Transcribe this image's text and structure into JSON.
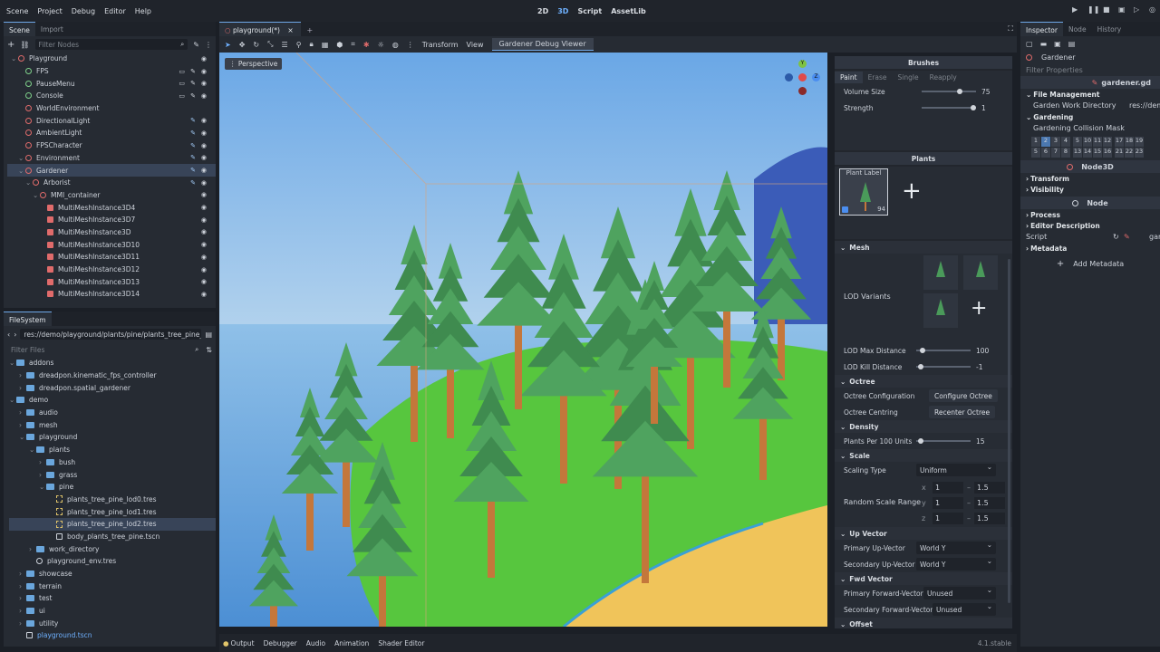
{
  "menu": [
    "Scene",
    "Project",
    "Debug",
    "Editor",
    "Help"
  ],
  "main_screens": [
    {
      "label": "2D",
      "active": false
    },
    {
      "label": "3D",
      "active": true
    },
    {
      "label": "Script",
      "active": false
    },
    {
      "label": "AssetLib",
      "active": false
    }
  ],
  "scene_dock": {
    "tabs": [
      "Scene",
      "Import"
    ],
    "filter_placeholder": "Filter Nodes",
    "nodes": [
      {
        "label": "Playground",
        "indent": 0,
        "icon": "node3d-icon",
        "eye": true
      },
      {
        "label": "FPS",
        "indent": 1,
        "icon": "control-icon",
        "eye": true
      },
      {
        "label": "PauseMenu",
        "indent": 1,
        "icon": "control-icon",
        "eye": true
      },
      {
        "label": "Console",
        "indent": 1,
        "icon": "control-icon",
        "eye": true
      },
      {
        "label": "WorldEnvironment",
        "indent": 1,
        "icon": "node3d-icon",
        "eye": false
      },
      {
        "label": "DirectionalLight",
        "indent": 1,
        "icon": "node3d-icon",
        "eye": true
      },
      {
        "label": "AmbientLight",
        "indent": 1,
        "icon": "node3d-icon",
        "eye": true
      },
      {
        "label": "FPSCharacter",
        "indent": 1,
        "icon": "node3d-icon",
        "eye": true
      },
      {
        "label": "Environment",
        "indent": 1,
        "icon": "node3d-icon",
        "eye": true
      },
      {
        "label": "Gardener",
        "indent": 1,
        "icon": "node3d-icon",
        "eye": true,
        "selected": true
      },
      {
        "label": "Arborist",
        "indent": 2,
        "icon": "node3d-icon",
        "eye": true
      },
      {
        "label": "MMI_container",
        "indent": 3,
        "icon": "node3d-icon",
        "eye": true
      },
      {
        "label": "MultiMeshInstance3D4",
        "indent": 4,
        "icon": "mesh-icon",
        "eye": true
      },
      {
        "label": "MultiMeshInstance3D7",
        "indent": 4,
        "icon": "mesh-icon",
        "eye": true
      },
      {
        "label": "MultiMeshInstance3D",
        "indent": 4,
        "icon": "mesh-icon",
        "eye": true
      },
      {
        "label": "MultiMeshInstance3D10",
        "indent": 4,
        "icon": "mesh-icon",
        "eye": true
      },
      {
        "label": "MultiMeshInstance3D11",
        "indent": 4,
        "icon": "mesh-icon",
        "eye": true
      },
      {
        "label": "MultiMeshInstance3D12",
        "indent": 4,
        "icon": "mesh-icon",
        "eye": true
      },
      {
        "label": "MultiMeshInstance3D13",
        "indent": 4,
        "icon": "mesh-icon",
        "eye": true
      },
      {
        "label": "MultiMeshInstance3D14",
        "indent": 4,
        "icon": "mesh-icon",
        "eye": true
      }
    ]
  },
  "filesystem": {
    "title": "FileSystem",
    "path": "res://demo/playground/plants/pine/plants_tree_pine_",
    "filter_placeholder": "Filter Files",
    "items": [
      {
        "label": "addons",
        "indent": 0,
        "type": "folder"
      },
      {
        "label": "dreadpon.kinematic_fps_controller",
        "indent": 1,
        "type": "folder"
      },
      {
        "label": "dreadpon.spatial_gardener",
        "indent": 1,
        "type": "folder"
      },
      {
        "label": "demo",
        "indent": 0,
        "type": "folder"
      },
      {
        "label": "audio",
        "indent": 1,
        "type": "folder"
      },
      {
        "label": "mesh",
        "indent": 1,
        "type": "folder"
      },
      {
        "label": "playground",
        "indent": 1,
        "type": "folder"
      },
      {
        "label": "plants",
        "indent": 2,
        "type": "folder"
      },
      {
        "label": "bush",
        "indent": 3,
        "type": "folder"
      },
      {
        "label": "grass",
        "indent": 3,
        "type": "folder"
      },
      {
        "label": "pine",
        "indent": 3,
        "type": "folder"
      },
      {
        "label": "plants_tree_pine_lod0.tres",
        "indent": 4,
        "type": "file"
      },
      {
        "label": "plants_tree_pine_lod1.tres",
        "indent": 4,
        "type": "file"
      },
      {
        "label": "plants_tree_pine_lod2.tres",
        "indent": 4,
        "type": "file",
        "selected": true
      },
      {
        "label": "body_plants_tree_pine.tscn",
        "indent": 4,
        "type": "scene"
      },
      {
        "label": "work_directory",
        "indent": 2,
        "type": "folder"
      },
      {
        "label": "playground_env.tres",
        "indent": 2,
        "type": "env"
      },
      {
        "label": "showcase",
        "indent": 1,
        "type": "folder"
      },
      {
        "label": "terrain",
        "indent": 1,
        "type": "folder"
      },
      {
        "label": "test",
        "indent": 1,
        "type": "folder"
      },
      {
        "label": "ui",
        "indent": 1,
        "type": "folder"
      },
      {
        "label": "utility",
        "indent": 1,
        "type": "folder"
      },
      {
        "label": "playground.tscn",
        "indent": 1,
        "type": "scene"
      }
    ]
  },
  "editor": {
    "tab_label": "playground(*)",
    "toolbar_menus": [
      "Transform",
      "View"
    ],
    "debug_viewer_label": "Gardener Debug Viewer",
    "perspective_label": "Perspective",
    "gizmo_labels": {
      "x": "X",
      "y": "Y",
      "z": "Z"
    }
  },
  "gardener": {
    "brushes_title": "Brushes",
    "brush_tabs": [
      "Paint",
      "Erase",
      "Single",
      "Reapply"
    ],
    "volume_label": "Volume Size",
    "volume_value": "75",
    "volume_fraction": 0.7,
    "strength_label": "Strength",
    "strength_value": "1",
    "strength_fraction": 0.95,
    "plants_title": "Plants",
    "plant_card_label": "Plant Label",
    "plant_card_count": "94",
    "mesh_section": "Mesh",
    "lod_variants_label": "LOD Variants",
    "lod_max_label": "LOD Max Distance",
    "lod_max_value": "100",
    "lod_kill_label": "LOD Kill Distance",
    "lod_kill_value": "-1",
    "octree_section": "Octree",
    "octree_config_label": "Octree Configuration",
    "octree_config_button": "Configure Octree",
    "octree_centring_label": "Octree Centring",
    "octree_centring_button": "Recenter Octree",
    "density_section": "Density",
    "plants_per_label": "Plants Per 100 Units",
    "plants_per_value": "15",
    "scale_section": "Scale",
    "scaling_type_label": "Scaling Type",
    "scaling_type_value": "Uniform",
    "random_scale_label": "Random Scale Range",
    "scale_rows": [
      {
        "axis": "x",
        "min": "1",
        "max": "1.5"
      },
      {
        "axis": "y",
        "min": "1",
        "max": "1.5"
      },
      {
        "axis": "z",
        "min": "1",
        "max": "1.5"
      }
    ],
    "up_vector_section": "Up Vector",
    "primary_up_label": "Primary Up-Vector",
    "primary_up_value": "World Y",
    "secondary_up_label": "Secondary Up-Vector",
    "secondary_up_value": "World Y",
    "fwd_vector_section": "Fwd Vector",
    "primary_fwd_label": "Primary Forward-Vector",
    "primary_fwd_value": "Unused",
    "secondary_fwd_label": "Secondary Forward-Vector",
    "secondary_fwd_value": "Unused",
    "offset_section": "Offset"
  },
  "inspector": {
    "tabs": [
      "Inspector",
      "Node",
      "History"
    ],
    "object_name": "Gardener",
    "filter_placeholder": "Filter Properties",
    "script_name": "gardener.gd",
    "file_management": "File Management",
    "garden_work_dir_label": "Garden Work Directory",
    "garden_work_dir_value": "res://dem",
    "gardening": "Gardening",
    "collision_mask_label": "Gardening Collision Mask",
    "mask_row1": [
      "1",
      "2",
      "3",
      "4",
      "5",
      "10",
      "11",
      "12",
      "17",
      "18",
      "19"
    ],
    "mask_row2": [
      "5",
      "6",
      "7",
      "8",
      "13",
      "14",
      "15",
      "16",
      "21",
      "22",
      "23"
    ],
    "node3d_label": "Node3D",
    "transform": "Transform",
    "visibility": "Visibility",
    "node_label": "Node",
    "process": "Process",
    "editor_description": "Editor Description",
    "script_label": "Script",
    "script_value": "gar",
    "metadata": "Metadata",
    "add_metadata": "Add Metadata"
  },
  "bottom_panel": {
    "tabs": [
      "Output",
      "Debugger",
      "Audio",
      "Animation",
      "Shader Editor"
    ],
    "version": "4.1.stable"
  },
  "colors": {
    "accent": "#6fb1ff",
    "sky_top": "#6aa7e6",
    "grass": "#55c33d",
    "tree": "#4a9a5a",
    "trunk": "#c4773b"
  }
}
